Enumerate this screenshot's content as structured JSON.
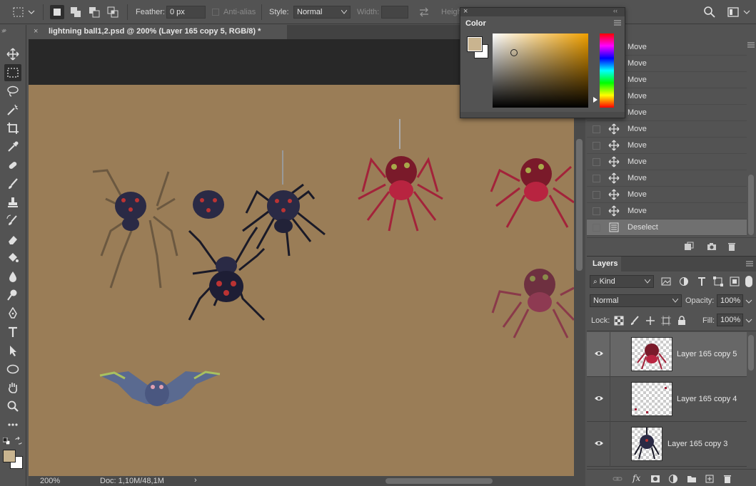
{
  "options_bar": {
    "feather_label": "Feather:",
    "feather_value": "0 px",
    "anti_alias_label": "Anti-alias",
    "style_label": "Style:",
    "style_value": "Normal",
    "width_label": "Width:",
    "height_label": "Heigh"
  },
  "document": {
    "tab_title": "lightning ball1,2.psd @ 200% (Layer 165 copy 5, RGB/8) *",
    "zoom": "200%",
    "doc_size": "Doc: 1,10M/48,1M"
  },
  "color_panel": {
    "title": "Color",
    "foreground": "#c9b48f",
    "background": "#ffffff"
  },
  "history": {
    "items": [
      {
        "label": "Move",
        "icon": "move-icon"
      },
      {
        "label": "Move",
        "icon": "move-icon"
      },
      {
        "label": "Move",
        "icon": "move-icon"
      },
      {
        "label": "Move",
        "icon": "move-icon"
      },
      {
        "label": "Move",
        "icon": "move-icon"
      },
      {
        "label": "Move",
        "icon": "move-icon"
      },
      {
        "label": "Move",
        "icon": "move-icon"
      },
      {
        "label": "Move",
        "icon": "move-icon"
      },
      {
        "label": "Move",
        "icon": "move-icon"
      },
      {
        "label": "Move",
        "icon": "move-icon"
      },
      {
        "label": "Move",
        "icon": "move-icon"
      },
      {
        "label": "Deselect",
        "icon": "document-icon"
      }
    ]
  },
  "layers": {
    "title": "Layers",
    "filter": "Kind",
    "blend_mode": "Normal",
    "opacity_label": "Opacity:",
    "opacity_value": "100%",
    "lock_label": "Lock:",
    "fill_label": "Fill:",
    "fill_value": "100%",
    "items": [
      {
        "name": "Layer 165 copy 5",
        "selected": true
      },
      {
        "name": "Layer 165 copy 4",
        "selected": false
      },
      {
        "name": "Layer 165 copy 3",
        "selected": false
      }
    ]
  },
  "colors": {
    "canvas": "#9a7d57",
    "panel": "#535353",
    "accent_selected": "#707070"
  }
}
